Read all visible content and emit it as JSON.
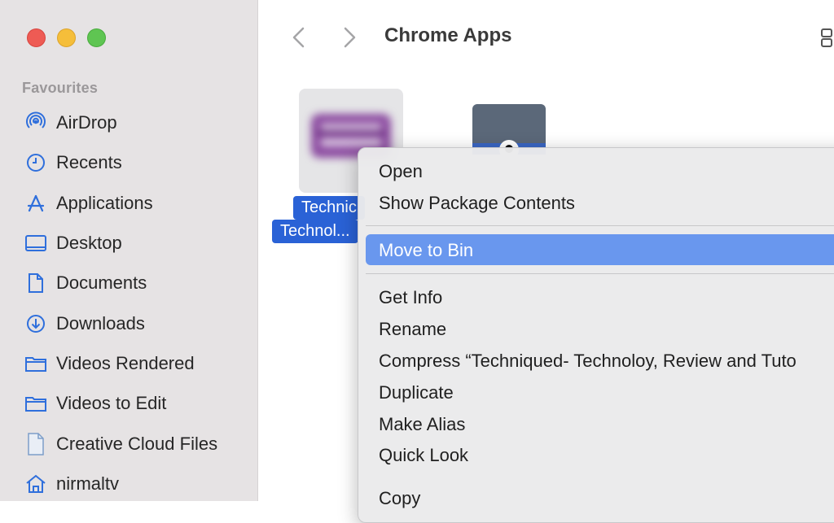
{
  "sidebar": {
    "heading": "Favourites",
    "items": [
      {
        "label": "AirDrop",
        "icon": "airdrop-icon"
      },
      {
        "label": "Recents",
        "icon": "clock-icon"
      },
      {
        "label": "Applications",
        "icon": "applications-icon"
      },
      {
        "label": "Desktop",
        "icon": "desktop-icon"
      },
      {
        "label": "Documents",
        "icon": "document-icon"
      },
      {
        "label": "Downloads",
        "icon": "download-icon"
      },
      {
        "label": "Videos Rendered",
        "icon": "folder-icon"
      },
      {
        "label": "Videos to Edit",
        "icon": "folder-icon"
      },
      {
        "label": "Creative Cloud Files",
        "icon": "file-icon"
      },
      {
        "label": "nirmaltv",
        "icon": "home-icon"
      }
    ]
  },
  "toolbar": {
    "title": "Chrome Apps"
  },
  "files": {
    "selected_line1": "Technic",
    "selected_line2": "Technol..."
  },
  "context_menu": {
    "items": [
      "Open",
      "Show Package Contents",
      "Move to Bin",
      "Get Info",
      "Rename",
      "Compress “Techniqued- Technoloy, Review and Tuto",
      "Duplicate",
      "Make Alias",
      "Quick Look",
      "Copy"
    ],
    "highlighted": "Move to Bin"
  },
  "colors": {
    "accent": "#2a62d6",
    "highlight": "#6997ee",
    "sidebar_icon": "#2f6fdc"
  }
}
